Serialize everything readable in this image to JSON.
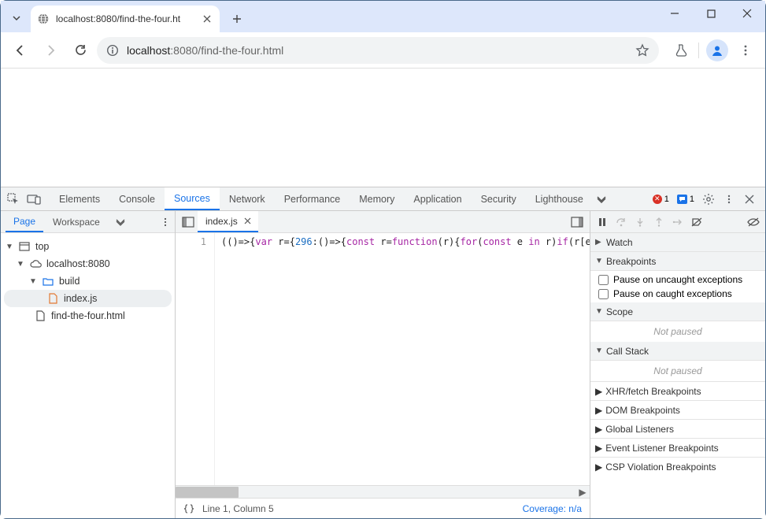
{
  "window": {
    "tab_title": "localhost:8080/find-the-four.ht"
  },
  "omnibox": {
    "host": "localhost",
    "port_path": ":8080/find-the-four.html"
  },
  "devtools": {
    "tabs": [
      "Elements",
      "Console",
      "Sources",
      "Network",
      "Performance",
      "Memory",
      "Application",
      "Security",
      "Lighthouse"
    ],
    "active_tab": "Sources",
    "error_count": "1",
    "message_count": "1",
    "left": {
      "tabs": [
        "Page",
        "Workspace"
      ],
      "active": "Page",
      "tree": {
        "top": "top",
        "origin": "localhost:8080",
        "folder": "build",
        "files": [
          "index.js",
          "find-the-four.html"
        ],
        "selected": "index.js"
      }
    },
    "center": {
      "open_file": "index.js",
      "line_number": "1",
      "status_position": "Line 1, Column 5",
      "coverage": "Coverage: n/a",
      "code": {
        "pre1": "(()=>{",
        "kw1": "var",
        "mid1": " r={",
        "num1": "296",
        "mid2": ":()=>{",
        "kw2": "const",
        "mid3": " r=",
        "kw3": "function",
        "mid4": "(r){",
        "kw4": "for",
        "mid5": "(",
        "kw5": "const",
        "mid6": " e ",
        "kw6": "in",
        "mid7": " r)",
        "kw7": "if",
        "mid8": "(r[e].inc"
      }
    },
    "right": {
      "sections": {
        "watch": "Watch",
        "breakpoints": "Breakpoints",
        "pause_uncaught": "Pause on uncaught exceptions",
        "pause_caught": "Pause on caught exceptions",
        "scope": "Scope",
        "not_paused": "Not paused",
        "callstack": "Call Stack",
        "xhr": "XHR/fetch Breakpoints",
        "dom": "DOM Breakpoints",
        "globals": "Global Listeners",
        "event": "Event Listener Breakpoints",
        "csp": "CSP Violation Breakpoints"
      }
    }
  }
}
